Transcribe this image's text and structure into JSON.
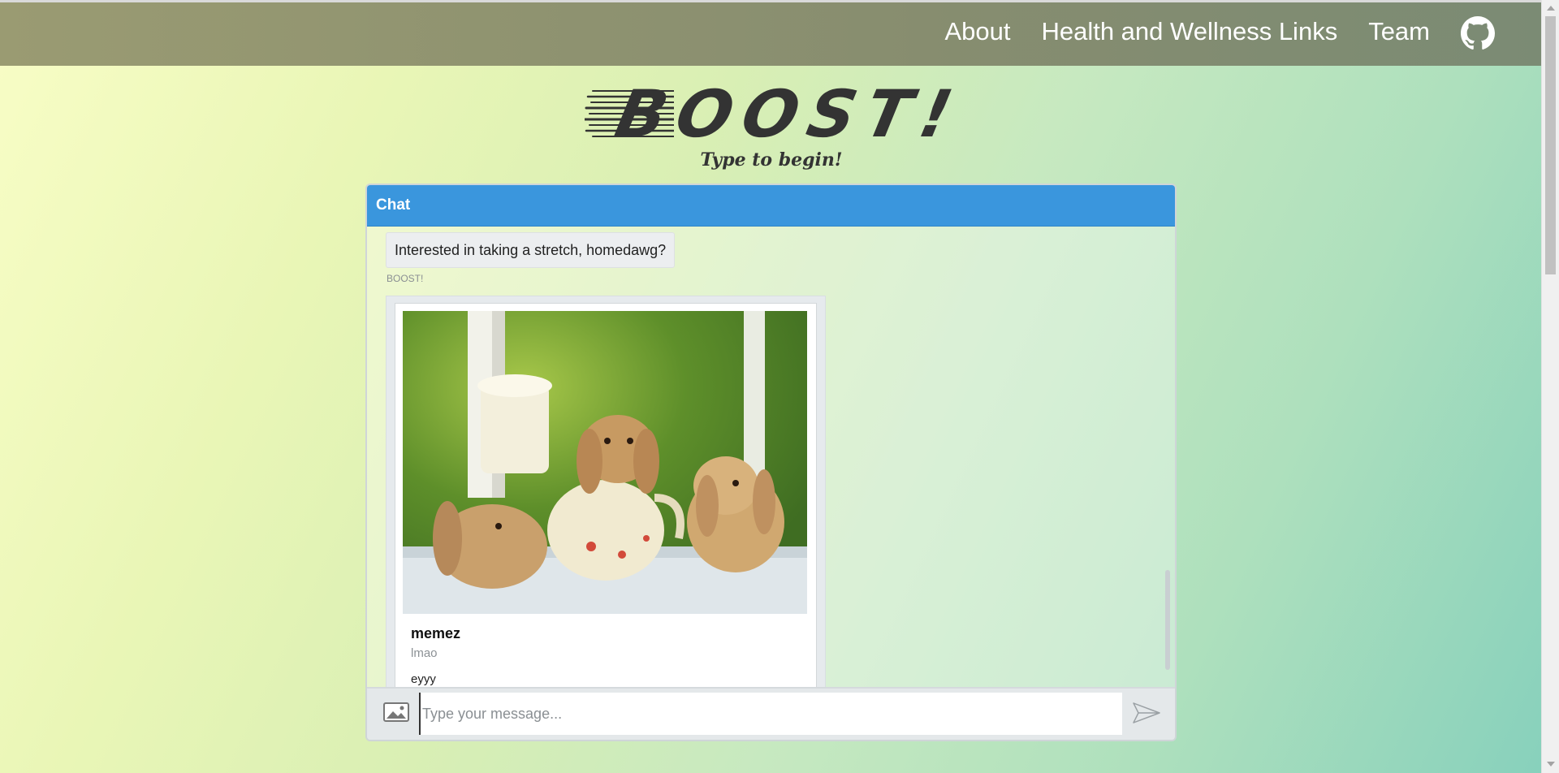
{
  "nav": {
    "items": [
      "About",
      "Health and Wellness Links",
      "Team"
    ],
    "github_icon": "github-icon"
  },
  "logo": {
    "text": "BOOST!"
  },
  "tagline": "Type to begin!",
  "chat": {
    "header": "Chat",
    "messages": [
      {
        "text": "Interested in taking a stretch, homedawg?",
        "sender": "BOOST!"
      }
    ],
    "card": {
      "title": "memez",
      "subtitle": "lmao",
      "text": "eyyy",
      "image_desc": "bunnies-with-teapot"
    },
    "input": {
      "placeholder": "Type your message..."
    },
    "icons": {
      "image": "image-upload-icon",
      "send": "send-icon"
    }
  },
  "colors": {
    "header_blue": "#3a96dd",
    "topbar": "#8a8f70"
  }
}
